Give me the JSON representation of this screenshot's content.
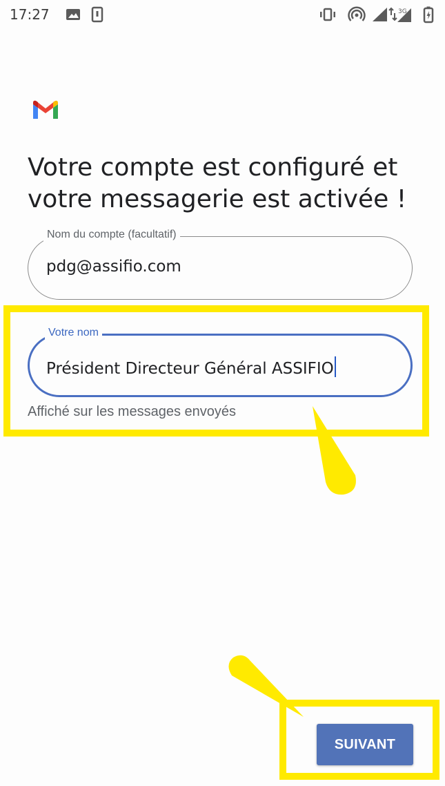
{
  "status_bar": {
    "time": "17:27",
    "network_label": "3G"
  },
  "app": {
    "logo_icon": "gmail-logo-icon"
  },
  "screen": {
    "title": "Votre compte est configuré et votre messagerie est activée !"
  },
  "form": {
    "account_name": {
      "label": "Nom du compte (facultatif)",
      "value": "pdg@assifio.com"
    },
    "your_name": {
      "label": "Votre nom",
      "value": "Président Directeur Général ASSIFIO",
      "helper": "Affiché sur les messages envoyés"
    }
  },
  "actions": {
    "next_label": "SUIVANT"
  },
  "colors": {
    "accent": "#4a6fc2",
    "button": "#5273b8",
    "annotation": "#ffea00"
  }
}
